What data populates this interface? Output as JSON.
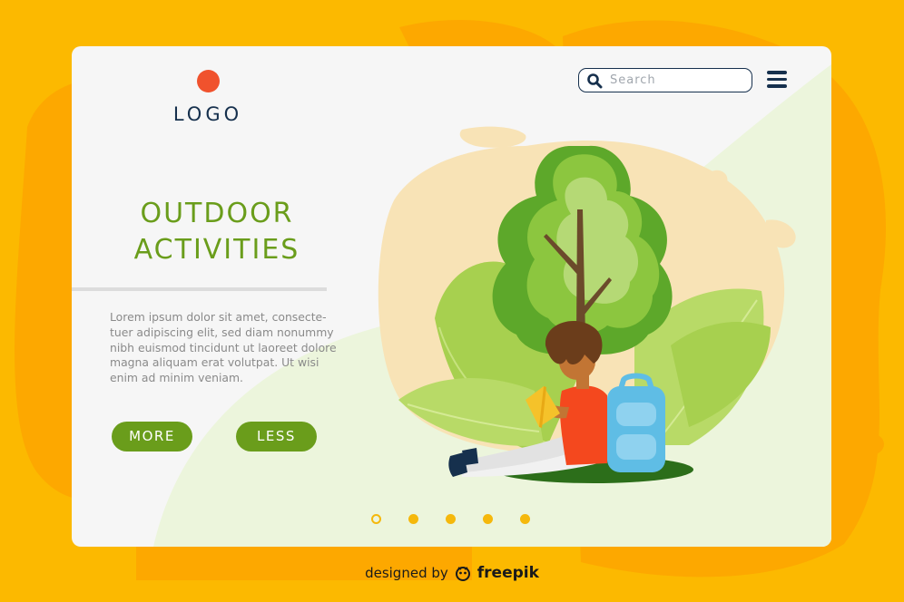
{
  "header": {
    "logo_text": "LOGO",
    "search_placeholder": "Search",
    "search_value": ""
  },
  "hero": {
    "title_line1": "OUTDOOR",
    "title_line2": "ACTIVITIES",
    "body_lines": [
      "Lorem ipsum dolor sit amet, consecte-",
      "tuer adipiscing elit, sed diam nonummy",
      "nibh euismod tincidunt ut laoreet dolore",
      "magna aliquam erat volutpat. Ut wisi",
      "enim ad minim veniam."
    ],
    "buttons": {
      "more": "MORE",
      "less": "LESS"
    }
  },
  "pagination": {
    "count": 5,
    "active_index": 0
  },
  "footer": {
    "credit_prefix": "designed by",
    "credit_brand": "freepik"
  },
  "icons": {
    "search": "search-icon",
    "menu": "hamburger-menu-icon",
    "logo": "logo-dot-icon",
    "brand": "freepik-logo-icon"
  },
  "colors": {
    "background": "#fcb900",
    "accent_green": "#6a9d1b",
    "navy": "#16304d",
    "logo_red": "#f0522d",
    "dot_yellow": "#f5b80c"
  }
}
